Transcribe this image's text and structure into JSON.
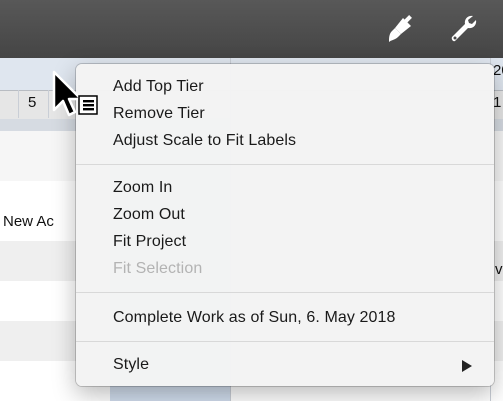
{
  "toolbar": {
    "icons": [
      "paintbrush-icon",
      "wrench-icon"
    ]
  },
  "background": {
    "scale_number_left": "5",
    "scale_number_right_top": "20",
    "scale_number_right_bottom": "1",
    "row_task_label": "New Ac",
    "row_right_fragment": "v"
  },
  "context_menu": {
    "items": [
      {
        "label": "Add Top Tier",
        "enabled": true
      },
      {
        "label": "Remove Tier",
        "enabled": true
      },
      {
        "label": "Adjust Scale to Fit Labels",
        "enabled": true
      },
      {
        "label": "Zoom In",
        "enabled": true
      },
      {
        "label": "Zoom Out",
        "enabled": true
      },
      {
        "label": "Fit Project",
        "enabled": true
      },
      {
        "label": "Fit Selection",
        "enabled": false
      },
      {
        "label": "Complete Work as of Sun, 6. May 2018",
        "enabled": true
      },
      {
        "label": "Style",
        "enabled": true,
        "submenu": true
      }
    ]
  },
  "colors": {
    "toolbar": "#4b4b4b",
    "menu_bg": "#f3f3f3",
    "disabled_text": "#b3b3b3",
    "scale_header": "#dfe6ef",
    "highlight_column": "#c9d7ea"
  }
}
